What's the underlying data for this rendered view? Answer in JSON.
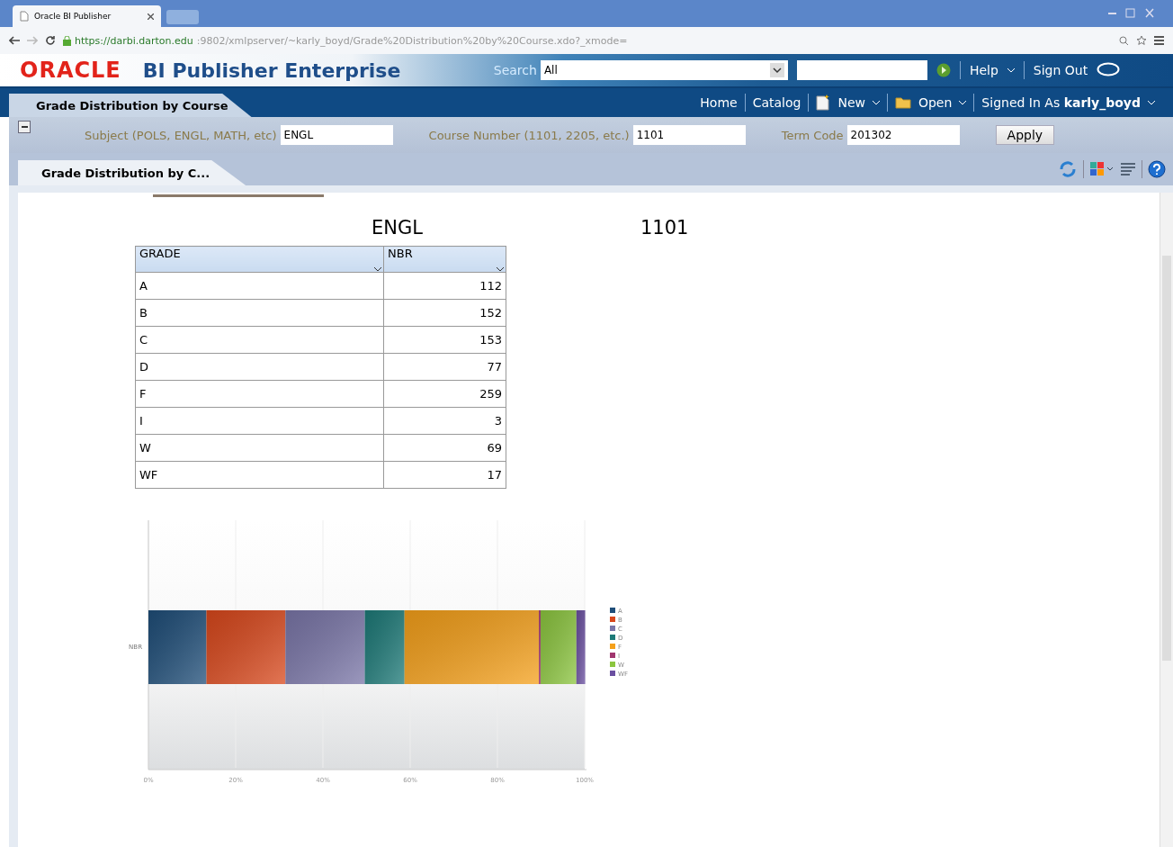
{
  "browser": {
    "tab_title": "Oracle BI Publisher",
    "url_host": "https://darbi.darton.edu",
    "url_rest": ":9802/xmlpserver/~karly_boyd/Grade%20Distribution%20by%20Course.xdo?_xmode="
  },
  "header": {
    "brand": "ORACLE",
    "product": "BI Publisher Enterprise",
    "search_label": "Search",
    "search_scope": "All",
    "help": "Help",
    "sign_out": "Sign Out"
  },
  "nav": {
    "page_tab": "Grade Distribution by Course",
    "links": [
      "Home",
      "Catalog"
    ],
    "new": "New",
    "open": "Open",
    "signed_in_label": "Signed In As",
    "user": "karly_boyd"
  },
  "params": [
    {
      "label": "Subject (POLS, ENGL, MATH, etc)",
      "value": "ENGL"
    },
    {
      "label": "Course Number (1101, 2205, etc.)",
      "value": "1101"
    },
    {
      "label": "Term Code",
      "value": "201302"
    }
  ],
  "apply": "Apply",
  "report_tab": "Grade Distribution by C...",
  "report": {
    "subject": "ENGL",
    "course": "1101",
    "table": {
      "columns": [
        "GRADE",
        "NBR"
      ],
      "rows": [
        [
          "A",
          "112"
        ],
        [
          "B",
          "152"
        ],
        [
          "C",
          "153"
        ],
        [
          "D",
          "77"
        ],
        [
          "F",
          "259"
        ],
        [
          "I",
          "3"
        ],
        [
          "W",
          "69"
        ],
        [
          "WF",
          "17"
        ]
      ]
    },
    "chart_data": {
      "type": "bar",
      "orientation": "horizontal",
      "stacked": true,
      "categories": [
        "NBR"
      ],
      "series": [
        {
          "name": "A",
          "color": "#1f4e79",
          "values": [
            13.3
          ]
        },
        {
          "name": "B",
          "color": "#d9481c",
          "values": [
            18.1
          ]
        },
        {
          "name": "C",
          "color": "#7a76a8",
          "values": [
            18.2
          ]
        },
        {
          "name": "D",
          "color": "#1d7a78",
          "values": [
            9.1
          ]
        },
        {
          "name": "F",
          "color": "#f5a01a",
          "values": [
            30.8
          ]
        },
        {
          "name": "I",
          "color": "#a0356e",
          "values": [
            0.4
          ]
        },
        {
          "name": "W",
          "color": "#8cc63f",
          "values": [
            8.2
          ]
        },
        {
          "name": "WF",
          "color": "#6a4fa0",
          "values": [
            2.0
          ]
        }
      ],
      "xlim": [
        0,
        100
      ],
      "grid": true,
      "legend": true,
      "xticks": [
        {
          "value": 0,
          "label": "0%"
        },
        {
          "value": 20,
          "label": "20%"
        },
        {
          "value": 40,
          "label": "40%"
        },
        {
          "value": 60,
          "label": "60%"
        },
        {
          "value": 80,
          "label": "80%"
        },
        {
          "value": 100,
          "label": "100%"
        }
      ]
    }
  }
}
